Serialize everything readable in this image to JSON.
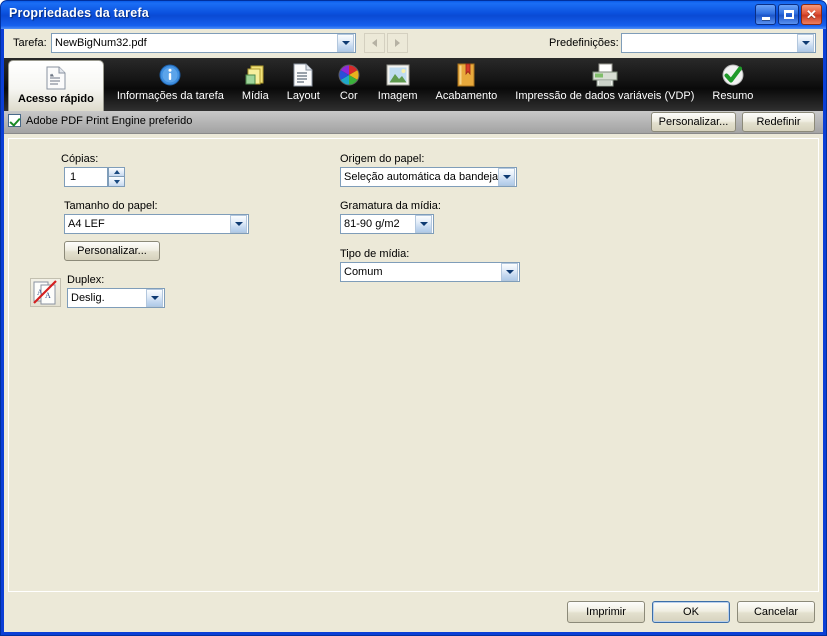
{
  "window": {
    "title": "Propriedades da tarefa",
    "controls": {
      "minimize": "Minimizar",
      "maximize": "Maximizar",
      "close": "Fechar"
    }
  },
  "jobbar": {
    "task_label": "Tarefa:",
    "task_value": "NewBigNum32.pdf",
    "task_placeholder": "",
    "prev_label": "Anterior",
    "next_label": "Próximo",
    "preset_label": "Predefinições:",
    "preset_value": "",
    "preset_placeholder": ""
  },
  "tabs": [
    {
      "label": "Acesso rápido",
      "icon": "document-lines-icon",
      "active": true
    },
    {
      "label": "Informações da tarefa",
      "icon": "info-circle-icon",
      "active": false
    },
    {
      "label": "Mídia",
      "icon": "media-folder-icon",
      "active": false
    },
    {
      "label": "Layout",
      "icon": "page-layout-icon",
      "active": false
    },
    {
      "label": "Cor",
      "icon": "color-wheel-icon",
      "active": false
    },
    {
      "label": "Imagem",
      "icon": "picture-icon",
      "active": false
    },
    {
      "label": "Acabamento",
      "icon": "booklet-icon",
      "active": false
    },
    {
      "label": "Impressão de dados variáveis (VDP)",
      "icon": "printer-icon",
      "active": false
    },
    {
      "label": "Resumo",
      "icon": "green-check-icon",
      "active": false
    }
  ],
  "optionbar": {
    "checkbox_label": "Adobe PDF Print Engine preferido",
    "checkbox_checked": true,
    "customize_label": "Personalizar...",
    "reset_label": "Redefinir"
  },
  "form": {
    "copies": {
      "label": "Cópias:",
      "value": "1"
    },
    "paper_size": {
      "label": "Tamanho do papel:",
      "value": "A4 LEF"
    },
    "customize_button": "Personalizar...",
    "duplex": {
      "label": "Duplex:",
      "value": "Deslig.",
      "icon": "duplex-off-icon"
    },
    "paper_source": {
      "label": "Origem do papel:",
      "value": "Seleção automática da bandeja"
    },
    "media_weight": {
      "label": "Gramatura da mídia:",
      "value": "81-90 g/m2"
    },
    "media_type": {
      "label": "Tipo de mídia:",
      "value": "Comum"
    }
  },
  "footer": {
    "print_label": "Imprimir",
    "ok_label": "OK",
    "cancel_label": "Cancelar"
  },
  "colors": {
    "title_blue": "#0b50dd",
    "panel_beige": "#ece9d8",
    "tabstrip_dark": "#141414",
    "check_green": "#1a8a24",
    "close_red": "#c93a22"
  }
}
